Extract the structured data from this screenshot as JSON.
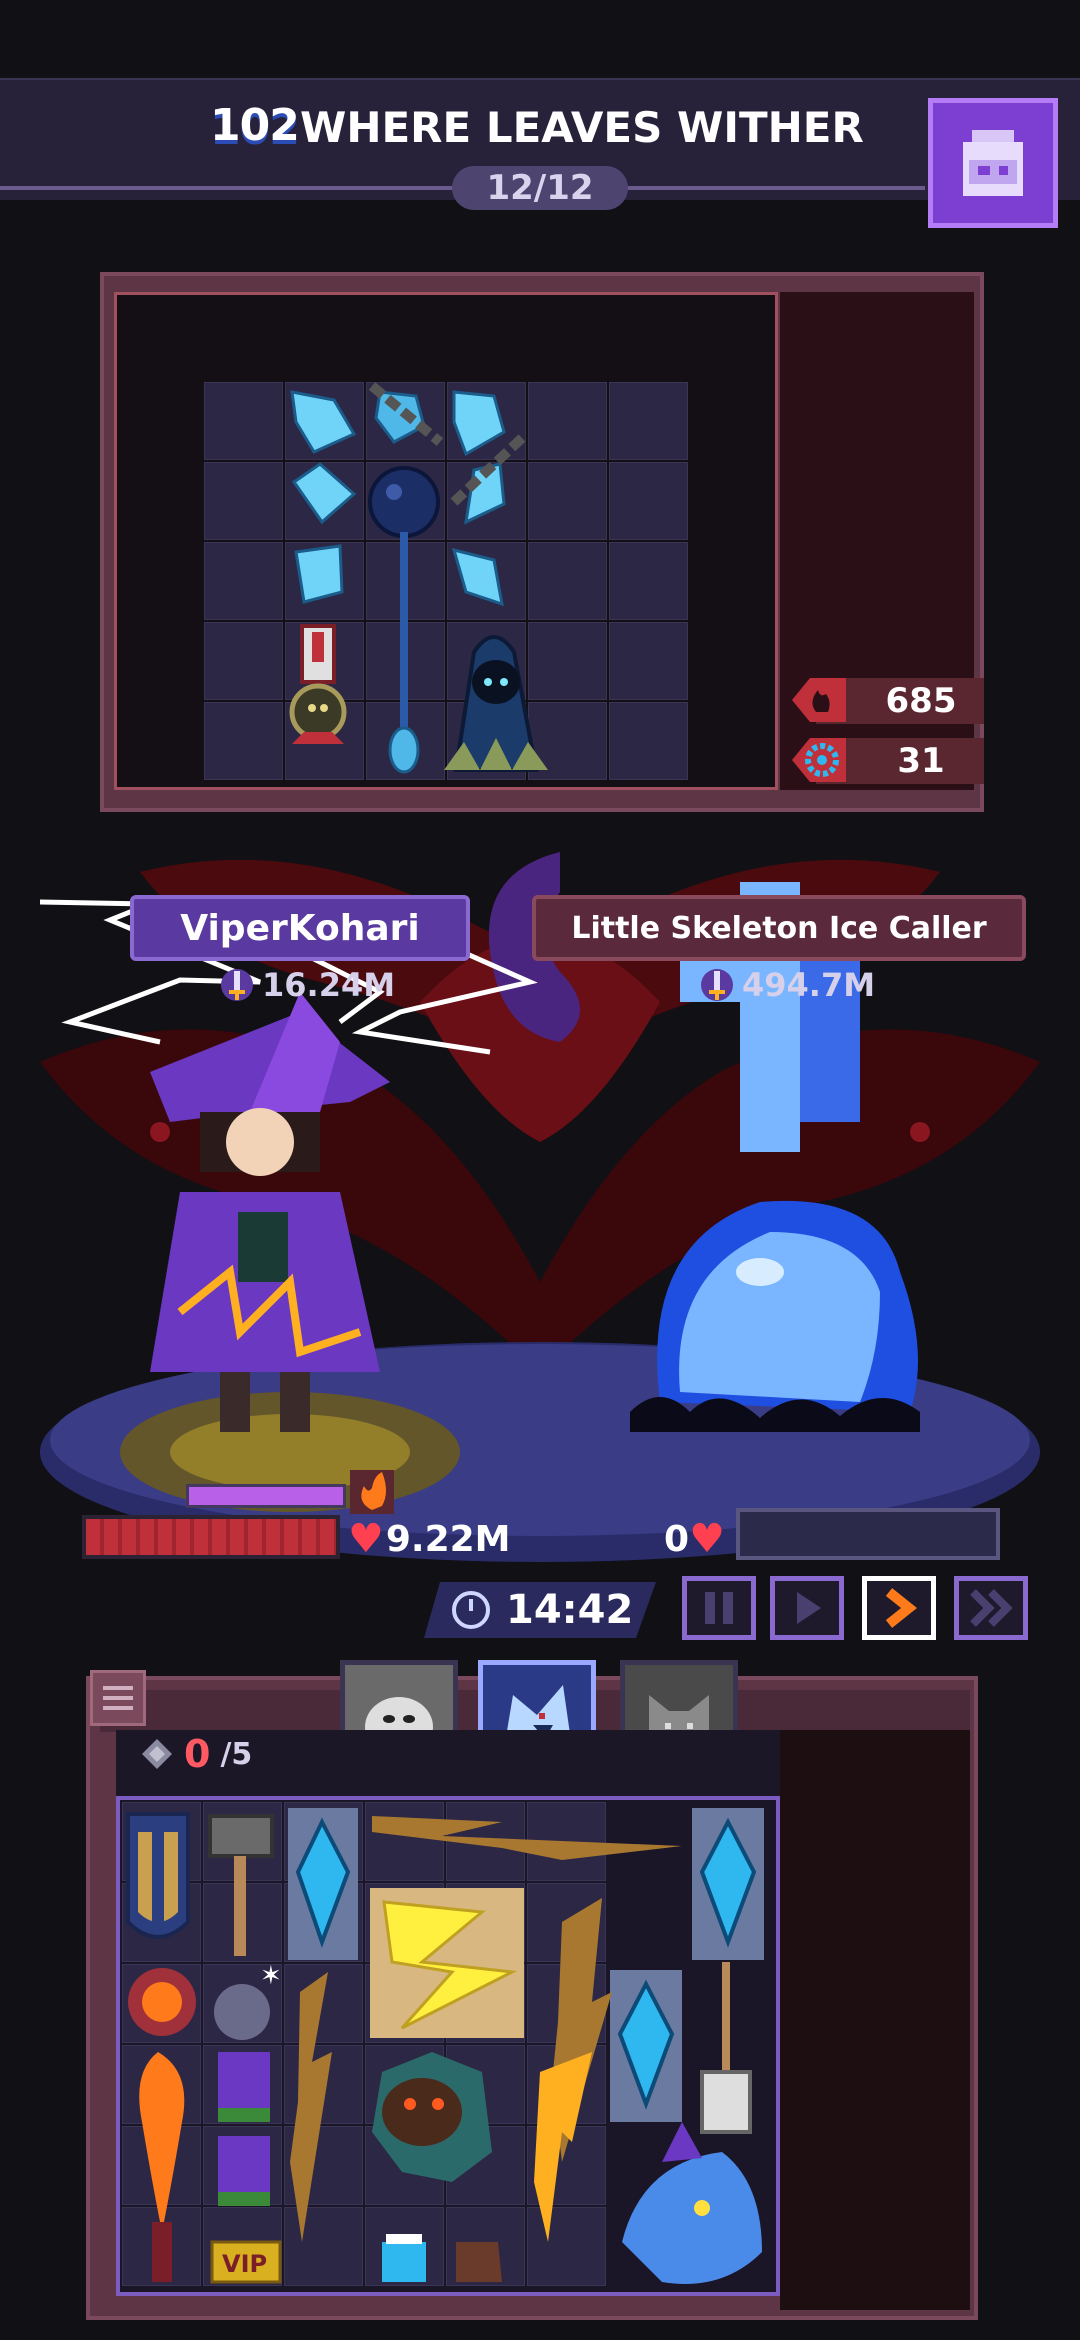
{
  "header": {
    "level": "102",
    "title": "WHERE LEAVES WITHER",
    "progress": "12/12",
    "backpack_icon": "backpack-icon"
  },
  "stats": {
    "attack_value": "685",
    "attack_icon": "flame-shield-icon",
    "defense_value": "31",
    "defense_icon": "gear-shield-icon"
  },
  "player": {
    "name": "ViperKohari",
    "power": "16.24M",
    "hp": "9.22M"
  },
  "enemy": {
    "name": "Little Skeleton Ice Caller",
    "power": "494.7M",
    "hp": "0"
  },
  "battle": {
    "timer": "14:42",
    "speed_controls": [
      "pause",
      "play",
      "fast",
      "faster"
    ],
    "active_speed": "fast"
  },
  "bag": {
    "slots_used": "0",
    "slots_total": "/5",
    "vip_label": "VIP",
    "tabs": [
      "ghost-pet",
      "wolf-pet",
      "cat-pet"
    ],
    "active_tab": "wolf-pet"
  },
  "colors": {
    "accent_purple": "#7d3fd2",
    "enemy_red": "#5a2a3c",
    "hp_red": "#c0303a",
    "active_speed": "#ff7a1a"
  }
}
